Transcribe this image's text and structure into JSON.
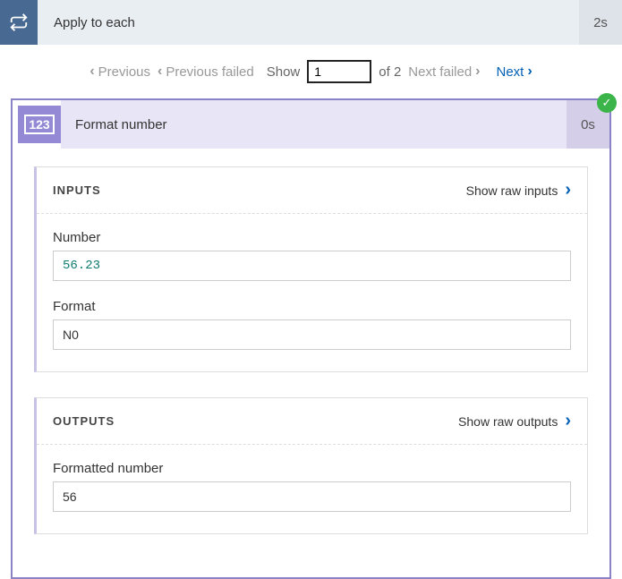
{
  "loop": {
    "title": "Apply to each",
    "duration": "2s"
  },
  "pager": {
    "previous": "Previous",
    "previous_failed": "Previous failed",
    "show_label": "Show",
    "current": "1",
    "of_text": "of 2",
    "next_failed": "Next failed",
    "next": "Next"
  },
  "card": {
    "icon_text": "123",
    "title": "Format number",
    "duration": "0s"
  },
  "inputs": {
    "section_title": "INPUTS",
    "raw_link": "Show raw inputs",
    "fields": {
      "number_label": "Number",
      "number_value": "56.23",
      "format_label": "Format",
      "format_value": "N0"
    }
  },
  "outputs": {
    "section_title": "OUTPUTS",
    "raw_link": "Show raw outputs",
    "fields": {
      "formatted_label": "Formatted number",
      "formatted_value": "56"
    }
  }
}
